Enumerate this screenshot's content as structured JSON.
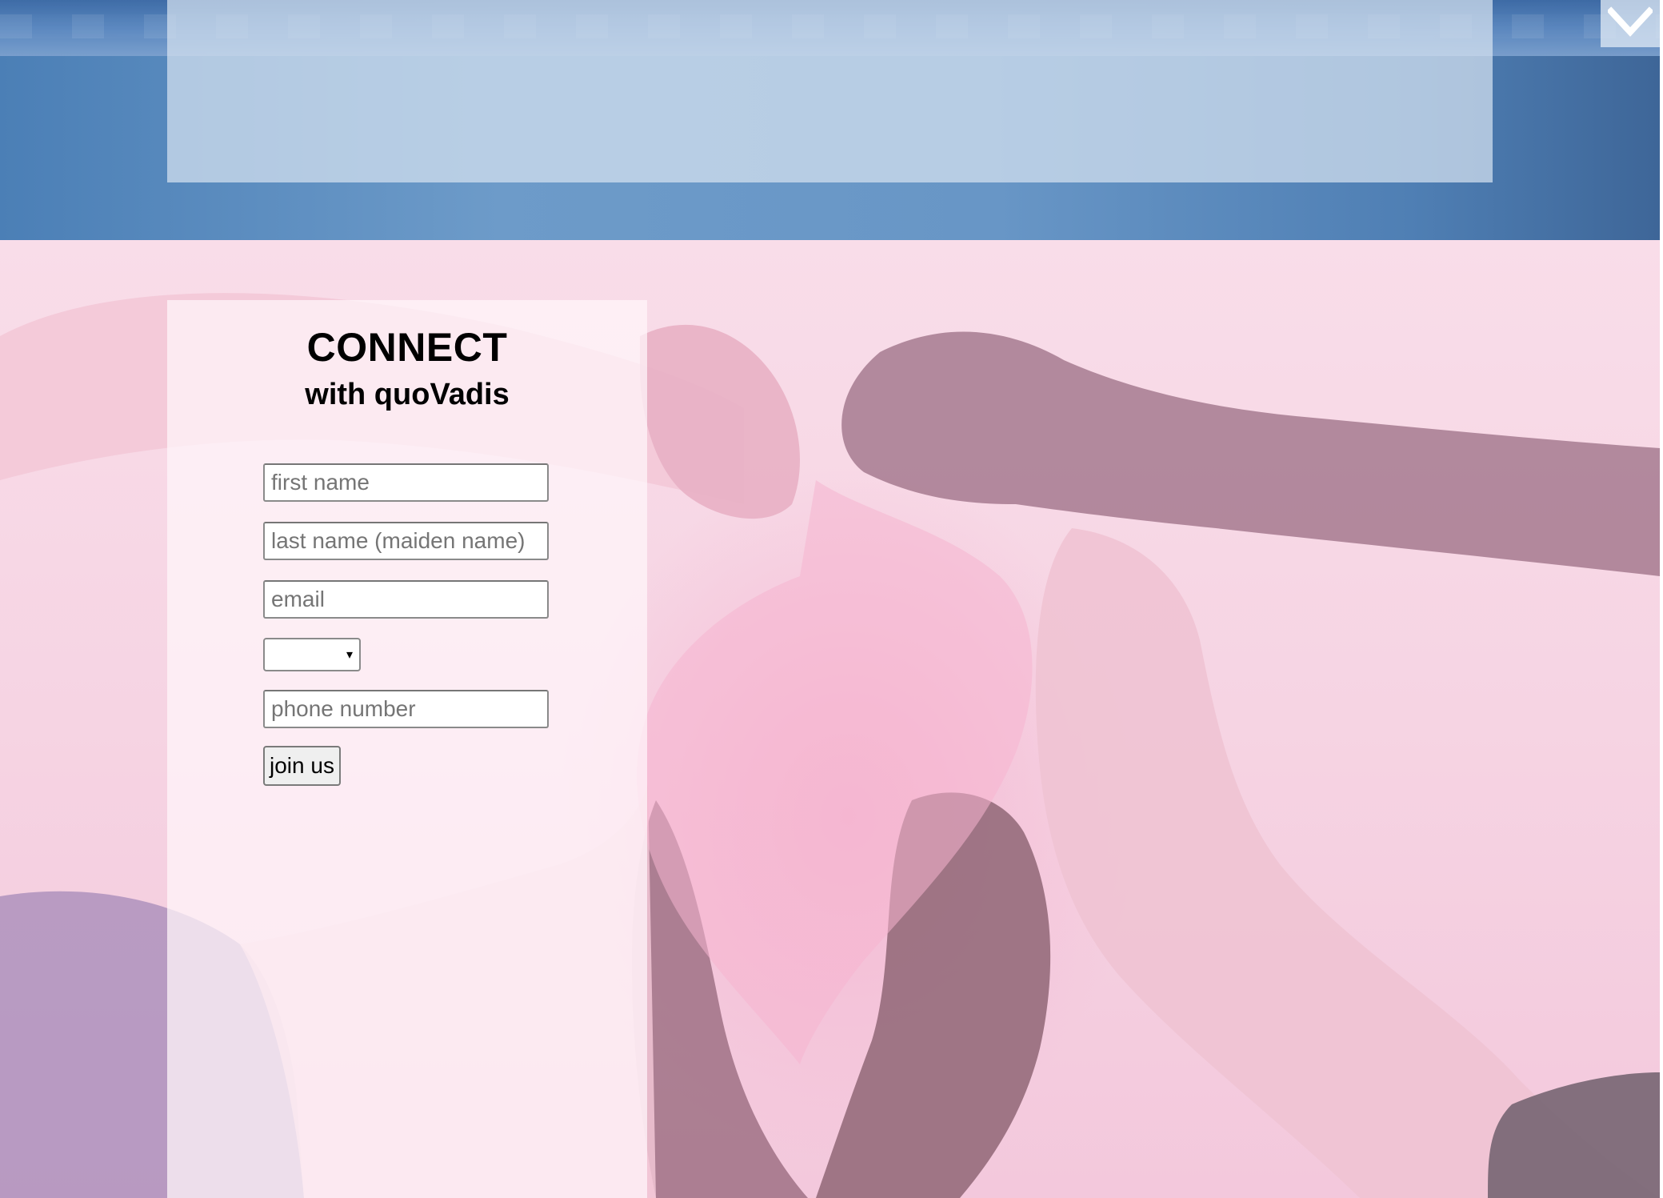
{
  "header": {
    "scroll_toggle_icon": "chevron-down-icon"
  },
  "signup_form": {
    "title": "CONNECT",
    "subtitle": "with quoVadis",
    "first_name_placeholder": "first name",
    "last_name_placeholder": "last name (maiden name)",
    "email_placeholder": "email",
    "select_value": "",
    "select_caret": "▾",
    "phone_placeholder": "phone number",
    "submit_label": "join us"
  },
  "colors": {
    "top_blue": "#5a8cc3",
    "hands_pink": "#f6d4e3",
    "panel_white": "#fff6fa"
  }
}
